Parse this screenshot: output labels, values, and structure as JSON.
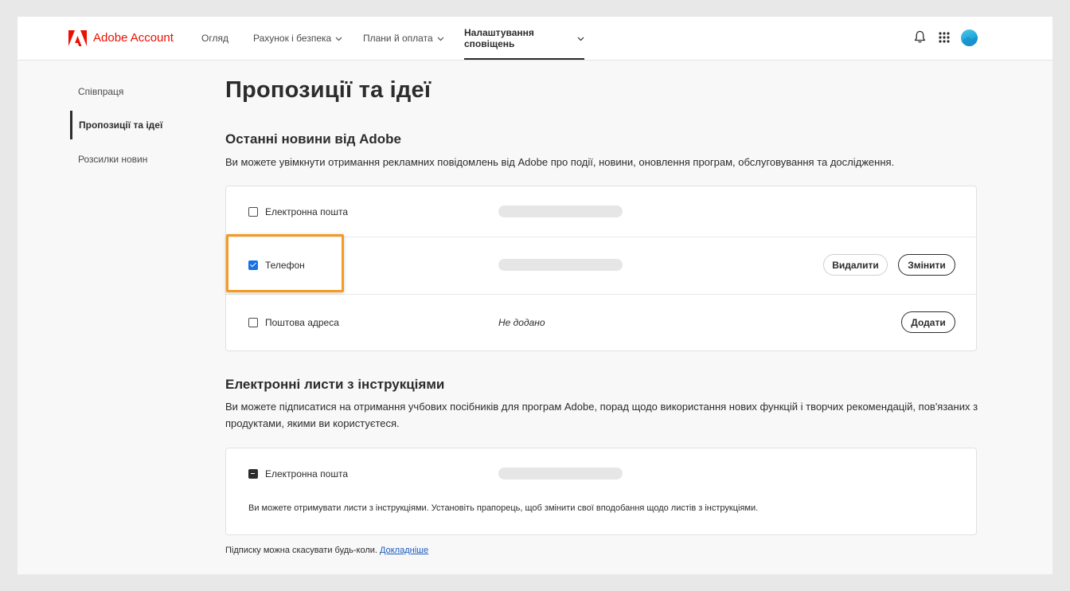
{
  "header": {
    "brand_name": "Adobe Account",
    "brand_color": "#eb1000",
    "nav": [
      {
        "label": "Огляд",
        "has_dropdown": false,
        "active": false
      },
      {
        "label": "Рахунок і безпека",
        "has_dropdown": true,
        "active": false
      },
      {
        "label": "Плани й оплата",
        "has_dropdown": true,
        "active": false
      },
      {
        "label": "Налаштування сповіщень",
        "has_dropdown": true,
        "active": true
      }
    ],
    "icons": [
      "bell-icon",
      "apps-grid-icon",
      "avatar"
    ]
  },
  "sidebar": {
    "items": [
      {
        "label": "Співпраця",
        "active": false
      },
      {
        "label": "Пропозиції та ідеї",
        "active": true
      },
      {
        "label": "Розсилки новин",
        "active": false
      }
    ]
  },
  "main": {
    "title": "Пропозиції та ідеї",
    "section1": {
      "title": "Останні новини від Adobe",
      "description": "Ви можете увімкнути отримання рекламних повідомлень від Adobe про події, новини, оновлення програм, обслуговування та дослідження.",
      "rows": [
        {
          "label": "Електронна пошта",
          "checked": false
        },
        {
          "label": "Телефон",
          "checked": true,
          "buttons": [
            "Видалити",
            "Змінити"
          ]
        },
        {
          "label": "Поштова адреса",
          "checked": false,
          "value": "Не додано",
          "buttons": [
            "Додати"
          ]
        }
      ]
    },
    "section2": {
      "title": "Електронні листи з інструкціями",
      "description": "Ви можете підписатися на отримання учбових посібників для програм Adobe, порад щодо використання нових функцій і творчих рекомендацій, пов'язаних з продуктами, якими ви користуєтеся.",
      "rows": [
        {
          "label": "Електронна пошта",
          "state": "indeterminate"
        }
      ],
      "note": "Ви можете отримувати листи з інструкціями. Установіть прапорець, щоб змінити свої вподобання щодо листів з інструкціями."
    },
    "footer": {
      "text": "Підписку можна скасувати будь-коли.",
      "link": "Докладніше"
    }
  },
  "colors": {
    "highlight": "#f59a23",
    "checkbox_checked": "#1473e6",
    "link": "#1e5bbf"
  }
}
